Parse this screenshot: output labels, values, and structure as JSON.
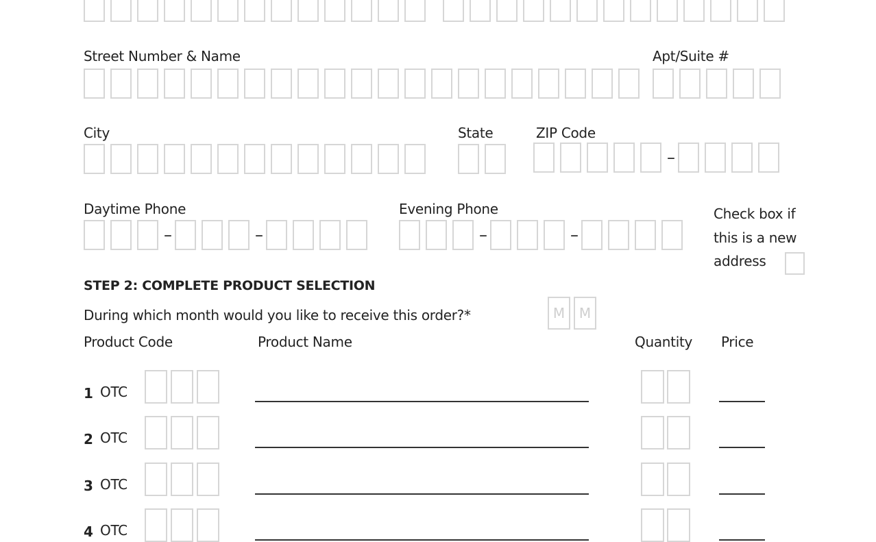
{
  "top_row": {
    "left_box_count": 13,
    "right_box_count": 13
  },
  "address": {
    "street_label": "Street Number & Name",
    "street_box_count": 21,
    "apt_label": "Apt/Suite #",
    "apt_box_count": 5,
    "city_label": "City",
    "city_box_count": 13,
    "state_label": "State",
    "state_box_count": 2,
    "zip_label": "ZIP Code",
    "zip_main_box_count": 5,
    "zip_ext_box_count": 4,
    "separator": "–"
  },
  "phones": {
    "daytime_label": "Daytime Phone",
    "evening_label": "Evening Phone",
    "groups": [
      3,
      3,
      4
    ],
    "separator": "–"
  },
  "new_address": {
    "line1": "Check box if",
    "line2": "this is a new",
    "line3": "address",
    "checked": false
  },
  "step2": {
    "heading": "STEP 2: COMPLETE PRODUCT SELECTION",
    "month_question": "During which month would you like to receive this order?*",
    "month_placeholder": [
      "M",
      "M"
    ]
  },
  "table": {
    "headers": {
      "code": "Product Code",
      "name": "Product Name",
      "quantity": "Quantity",
      "price": "Price"
    },
    "rows": [
      {
        "number": "1",
        "prefix": "OTC"
      },
      {
        "number": "2",
        "prefix": "OTC"
      },
      {
        "number": "3",
        "prefix": "OTC"
      },
      {
        "number": "4",
        "prefix": "OTC"
      }
    ]
  }
}
